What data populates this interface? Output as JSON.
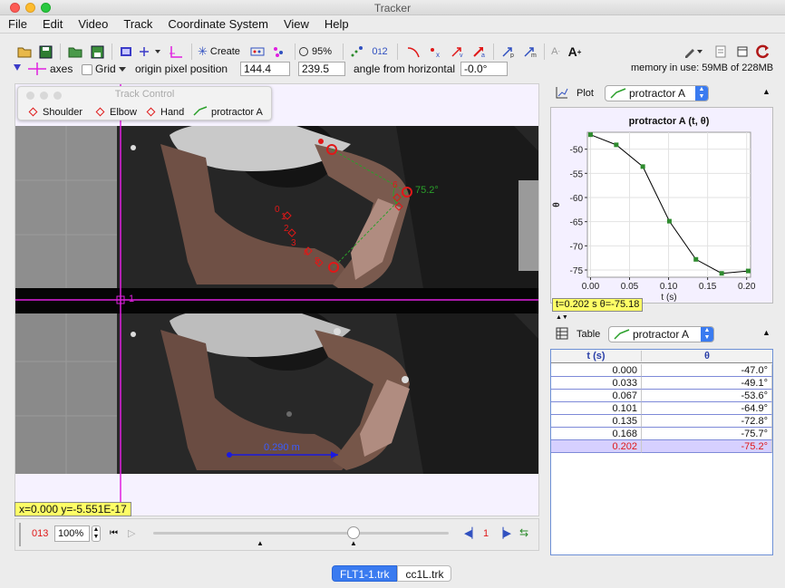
{
  "window": {
    "title": "Tracker"
  },
  "menu": [
    "File",
    "Edit",
    "Video",
    "Track",
    "Coordinate System",
    "View",
    "Help"
  ],
  "toolbar": {
    "create_label": "Create",
    "zoom_label": "95%",
    "memory_label": "memory in use: 59MB of 228MB"
  },
  "axes_bar": {
    "axes_label": "axes",
    "grid_label": "Grid",
    "origin_label": "origin pixel position",
    "origin_x": "144.4",
    "origin_y": "239.5",
    "angle_label": "angle from horizontal",
    "angle_value": "-0.0°"
  },
  "track_control": {
    "title": "Track Control",
    "tracks": [
      "Shoulder",
      "Elbow",
      "Hand",
      "protractor A"
    ]
  },
  "video": {
    "angle_readout": "75.2°",
    "point_labels": [
      "0",
      "1",
      "2",
      "3",
      "4",
      "5",
      "6"
    ],
    "tape_label": "0.290 m",
    "axis_label": "1",
    "status": "x=0.000  y=-5.551E-17"
  },
  "player": {
    "frame": "013",
    "zoom": "100%",
    "step": "1"
  },
  "plot_panel": {
    "tab_label": "Plot",
    "track_label": "protractor A",
    "readout": "t=0.202 s  θ=-75.18"
  },
  "table_panel": {
    "tab_label": "Table",
    "track_label": "protractor A",
    "columns": [
      "t (s)",
      "θ"
    ],
    "rows": [
      [
        "0.000",
        "-47.0°"
      ],
      [
        "0.033",
        "-49.1°"
      ],
      [
        "0.067",
        "-53.6°"
      ],
      [
        "0.101",
        "-64.9°"
      ],
      [
        "0.135",
        "-72.8°"
      ],
      [
        "0.168",
        "-75.7°"
      ],
      [
        "0.202",
        "-75.2°"
      ]
    ],
    "selected_row": 6
  },
  "tabs": [
    "FLT1-1.trk",
    "cc1L.trk"
  ],
  "chart_data": {
    "type": "line",
    "title": "protractor A (t, θ)",
    "xlabel": "t (s)",
    "ylabel": "θ",
    "x": [
      0.0,
      0.033,
      0.067,
      0.101,
      0.135,
      0.168,
      0.202
    ],
    "y": [
      -47.0,
      -49.1,
      -53.6,
      -64.9,
      -72.8,
      -75.7,
      -75.2
    ],
    "xlim": [
      -0.004,
      0.205
    ],
    "ylim": [
      -76.5,
      -46.5
    ],
    "xticks": [
      "0.00",
      "0.05",
      "0.10",
      "0.15",
      "0.20"
    ],
    "yticks": [
      "-50",
      "-55",
      "-60",
      "-65",
      "-70",
      "-75"
    ],
    "grid": true,
    "colors": {
      "line": "#000000",
      "marker": "#2e8b2e"
    }
  },
  "colors": {
    "axes": "#e020e0",
    "track": "#e01818",
    "protractor": "#2aa02a",
    "tape": "#1a1ae0",
    "selected_row_text": "#e01818",
    "selected_row_bg": "#d6d0ff"
  }
}
